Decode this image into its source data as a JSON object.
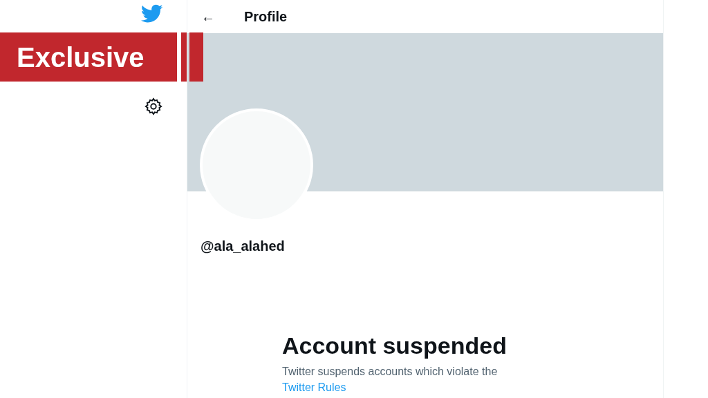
{
  "overlay_label": "Exclusive",
  "header": {
    "back": "←",
    "title": "Profile"
  },
  "profile": {
    "handle": "@ala_alahed"
  },
  "notice": {
    "title": "Account suspended",
    "text": "Twitter suspends accounts which violate the",
    "link": "Twitter Rules"
  }
}
